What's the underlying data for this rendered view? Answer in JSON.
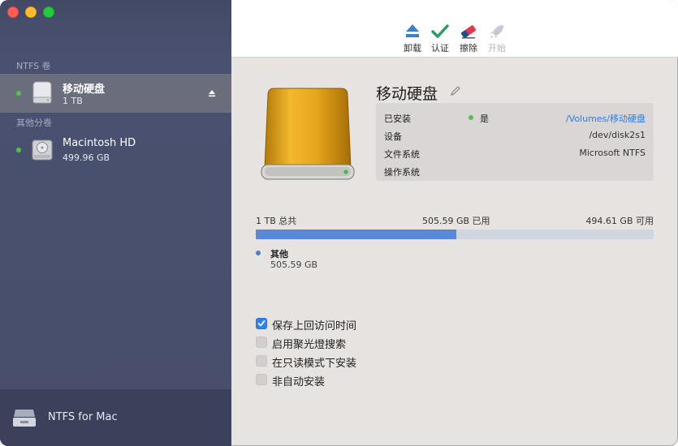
{
  "sidebar": {
    "sections": [
      {
        "label": "NTFS 卷"
      },
      {
        "label": "其他分卷"
      }
    ],
    "items": [
      {
        "name": "移动硬盘",
        "size": "1 TB"
      },
      {
        "name": "Macintosh HD",
        "size": "499.96 GB"
      }
    ],
    "footer": {
      "label": "NTFS for Mac"
    }
  },
  "toolbar": {
    "buttons": [
      {
        "label": "卸载",
        "icon": "eject-icon"
      },
      {
        "label": "认证",
        "icon": "checkmark-icon"
      },
      {
        "label": "擦除",
        "icon": "eraser-icon"
      },
      {
        "label": "开始",
        "icon": "rocket-icon"
      }
    ]
  },
  "drive": {
    "title": "移动硬盘",
    "info": [
      {
        "key": "已安装",
        "status": "是",
        "value": "/Volumes/移动硬盘"
      },
      {
        "key": "设备",
        "value": "/dev/disk2s1"
      },
      {
        "key": "文件系统",
        "value": "Microsoft NTFS"
      },
      {
        "key": "操作系统",
        "value": ""
      }
    ],
    "usage": {
      "total": "1 TB 总共",
      "used": "505.59 GB 已用",
      "available": "494.61 GB 可用",
      "used_fraction": 0.505
    },
    "legend": {
      "name": "其他",
      "size": "505.59 GB"
    }
  },
  "options": [
    {
      "label": "保存上回访问时间",
      "checked": true
    },
    {
      "label": "启用聚光燈搜索",
      "checked": false
    },
    {
      "label": "在只读模式下安装",
      "checked": false
    },
    {
      "label": "非自动安装",
      "checked": false
    }
  ],
  "colors": {
    "sidebar": "#474e6a",
    "selected": "#6a6e7c",
    "accent": "#2f7ff0",
    "usage_bar": "#5a8ad6",
    "mounted": "#4fc34f"
  }
}
